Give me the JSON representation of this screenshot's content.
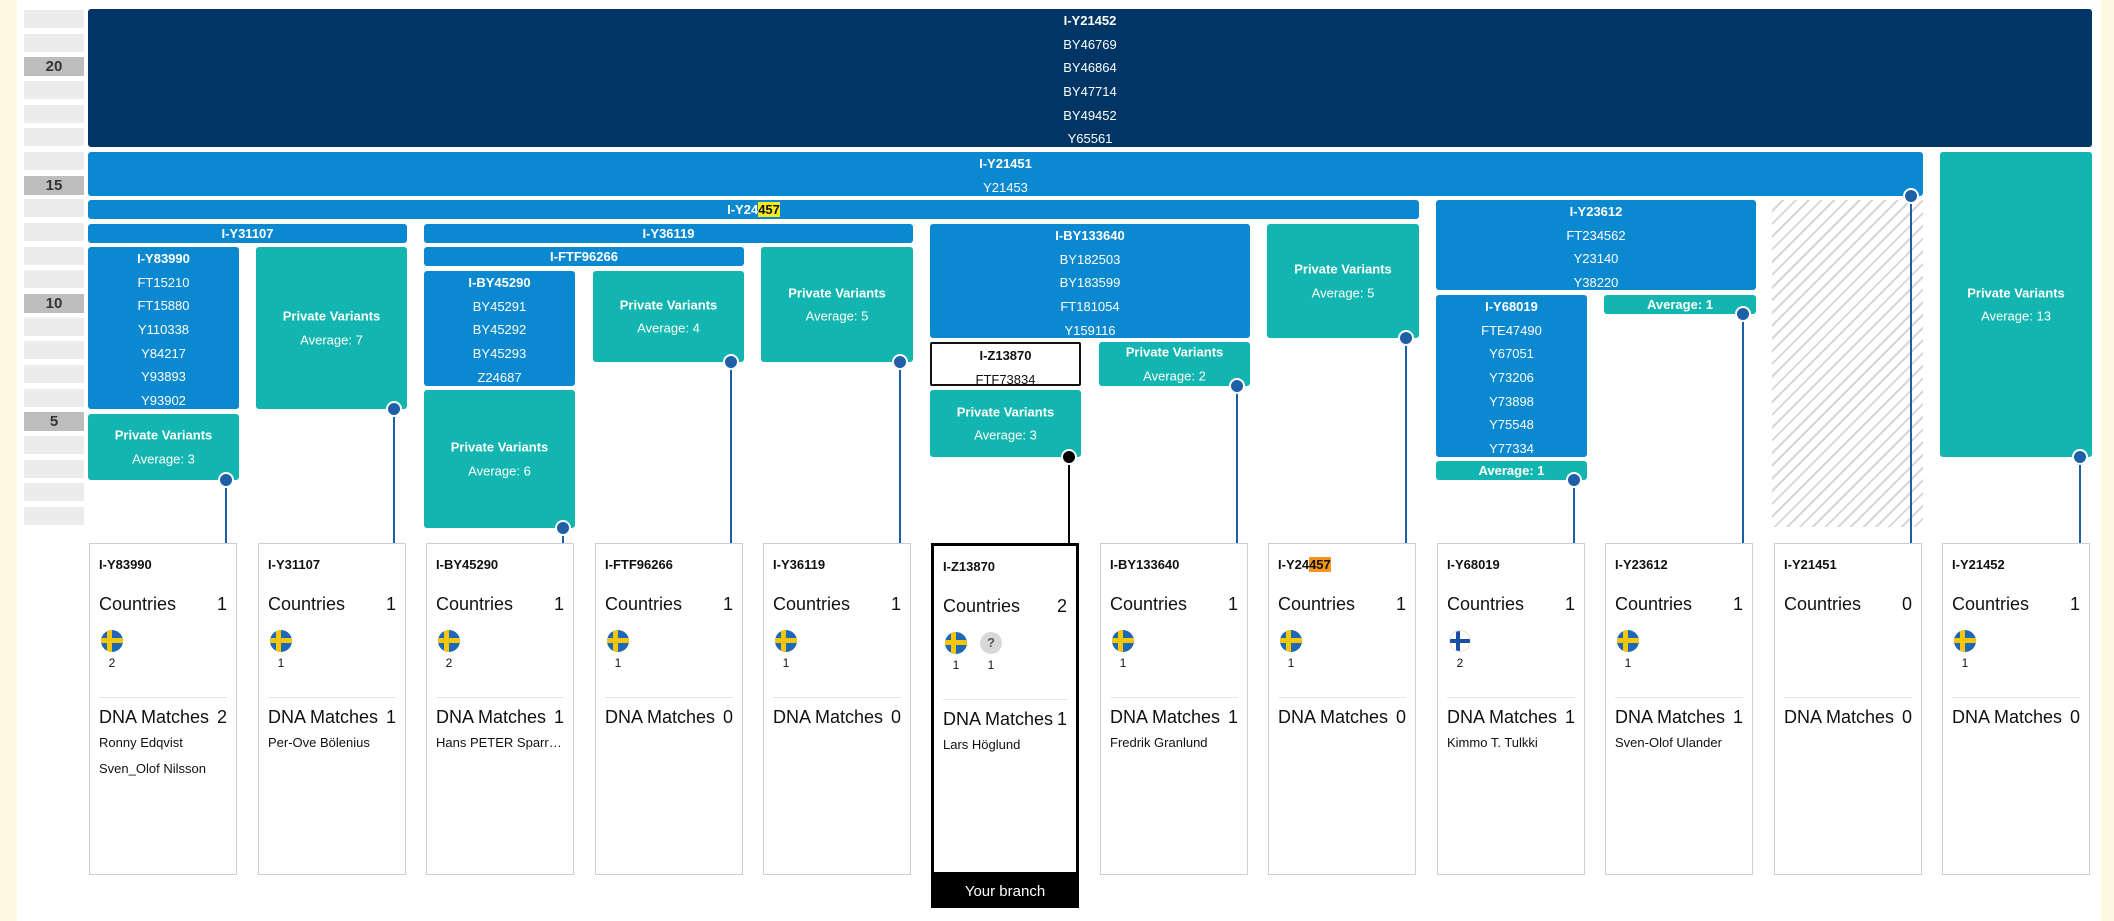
{
  "scale": {
    "labels": [
      "20",
      "15",
      "10",
      "5"
    ]
  },
  "tree": {
    "root": {
      "lines": [
        "I-Y21452",
        "BY46769",
        "BY46864",
        "BY47714",
        "BY49452",
        "Y65561"
      ]
    },
    "y21451": {
      "lines": [
        "I-Y21451",
        "Y21453"
      ]
    },
    "y24457": {
      "prefix": "I-Y24",
      "highlight": "457"
    },
    "y31107": {
      "label": "I-Y31107"
    },
    "y36119": {
      "label": "I-Y36119"
    },
    "y83990": {
      "lines": [
        "I-Y83990",
        "FT15210",
        "FT15880",
        "Y110338",
        "Y84217",
        "Y93893",
        "Y93902"
      ]
    },
    "pv_y83990": {
      "title": "Private Variants",
      "avg": "Average: 3"
    },
    "pv_y31107": {
      "title": "Private Variants",
      "avg": "Average: 7"
    },
    "ftf96266": {
      "label": "I-FTF96266"
    },
    "by45290": {
      "lines": [
        "I-BY45290",
        "BY45291",
        "BY45292",
        "BY45293",
        "Z24687"
      ]
    },
    "pv_by45290": {
      "title": "Private Variants",
      "avg": "Average: 6"
    },
    "pv_ftf96266": {
      "title": "Private Variants",
      "avg": "Average: 4"
    },
    "pv_y36119": {
      "title": "Private Variants",
      "avg": "Average: 5"
    },
    "by133640": {
      "lines": [
        "I-BY133640",
        "BY182503",
        "BY183599",
        "FT181054",
        "Y159116"
      ]
    },
    "z13870": {
      "lines": [
        "I-Z13870",
        "FTF73834"
      ]
    },
    "pv_z13870": {
      "title": "Private Variants",
      "avg": "Average: 3"
    },
    "pv_by133640": {
      "title": "Private Variants",
      "avg": "Average: 2"
    },
    "pv_y24457": {
      "title": "Private Variants",
      "avg": "Average: 5"
    },
    "y23612": {
      "lines": [
        "I-Y23612",
        "FT234562",
        "Y23140",
        "Y38220"
      ]
    },
    "y68019": {
      "lines": [
        "I-Y68019",
        "FTE47490",
        "Y67051",
        "Y73206",
        "Y73898",
        "Y75548",
        "Y77334"
      ]
    },
    "avg_y68019": {
      "label": "Average: 1"
    },
    "avg_y23612": {
      "label": "Average: 1"
    },
    "pv_y21452": {
      "title": "Private Variants",
      "avg": "Average: 13"
    }
  },
  "cards": [
    {
      "title": "I-Y83990",
      "countries_label": "Countries",
      "countries": "1",
      "flags": [
        {
          "type": "se",
          "count": "2"
        }
      ],
      "matches_label": "DNA Matches",
      "matches": "2",
      "names": [
        "Ronny Edqvist",
        "Sven_Olof Nilsson"
      ]
    },
    {
      "title": "I-Y31107",
      "countries_label": "Countries",
      "countries": "1",
      "flags": [
        {
          "type": "se",
          "count": "1"
        }
      ],
      "matches_label": "DNA Matches",
      "matches": "1",
      "names": [
        "Per-Ove Bölenius"
      ]
    },
    {
      "title": "I-BY45290",
      "countries_label": "Countries",
      "countries": "1",
      "flags": [
        {
          "type": "se",
          "count": "2"
        }
      ],
      "matches_label": "DNA Matches",
      "matches": "1",
      "names": [
        "Hans PETER Sparre…"
      ]
    },
    {
      "title": "I-FTF96266",
      "countries_label": "Countries",
      "countries": "1",
      "flags": [
        {
          "type": "se",
          "count": "1"
        }
      ],
      "matches_label": "DNA Matches",
      "matches": "0",
      "names": []
    },
    {
      "title": "I-Y36119",
      "countries_label": "Countries",
      "countries": "1",
      "flags": [
        {
          "type": "se",
          "count": "1"
        }
      ],
      "matches_label": "DNA Matches",
      "matches": "0",
      "names": []
    },
    {
      "title": "I-Z13870",
      "countries_label": "Countries",
      "countries": "2",
      "flags": [
        {
          "type": "se",
          "count": "1"
        },
        {
          "type": "unknown",
          "count": "1"
        }
      ],
      "matches_label": "DNA Matches",
      "matches": "1",
      "names": [
        "Lars Höglund"
      ],
      "selected": true
    },
    {
      "title": "I-BY133640",
      "countries_label": "Countries",
      "countries": "1",
      "flags": [
        {
          "type": "se",
          "count": "1"
        }
      ],
      "matches_label": "DNA Matches",
      "matches": "1",
      "names": [
        "Fredrik Granlund"
      ]
    },
    {
      "title": "I-Y24457",
      "title_prefix": "I-Y24",
      "title_highlight": "457",
      "countries_label": "Countries",
      "countries": "1",
      "flags": [
        {
          "type": "se",
          "count": "1"
        }
      ],
      "matches_label": "DNA Matches",
      "matches": "0",
      "names": []
    },
    {
      "title": "I-Y68019",
      "countries_label": "Countries",
      "countries": "1",
      "flags": [
        {
          "type": "fi",
          "count": "2"
        }
      ],
      "matches_label": "DNA Matches",
      "matches": "1",
      "names": [
        "Kimmo T. Tulkki"
      ]
    },
    {
      "title": "I-Y23612",
      "countries_label": "Countries",
      "countries": "1",
      "flags": [
        {
          "type": "se",
          "count": "1"
        }
      ],
      "matches_label": "DNA Matches",
      "matches": "1",
      "names": [
        "Sven-Olof Ulander"
      ]
    },
    {
      "title": "I-Y21451",
      "countries_label": "Countries",
      "countries": "0",
      "flags": [],
      "matches_label": "DNA Matches",
      "matches": "0",
      "names": []
    },
    {
      "title": "I-Y21452",
      "countries_label": "Countries",
      "countries": "1",
      "flags": [
        {
          "type": "se",
          "count": "1"
        }
      ],
      "matches_label": "DNA Matches",
      "matches": "0",
      "names": []
    }
  ],
  "your_branch": {
    "label": "Your branch"
  },
  "colors": {
    "navy": "#003565",
    "blue": "#0a88d0",
    "teal": "#12b5b0",
    "connector": "#1e5fa8",
    "highlight_yellow": "#f5ea1f",
    "highlight_orange": "#f7941d"
  }
}
